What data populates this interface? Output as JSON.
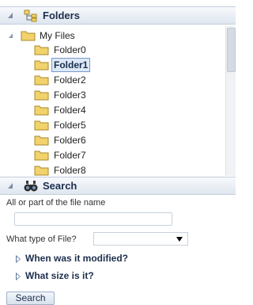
{
  "folders_panel": {
    "title": "Folders",
    "icon": "folder-tree-icon",
    "root": {
      "label": "My Files",
      "expanded": true
    },
    "items": [
      {
        "label": "Folder0",
        "selected": false
      },
      {
        "label": "Folder1",
        "selected": true
      },
      {
        "label": "Folder2",
        "selected": false
      },
      {
        "label": "Folder3",
        "selected": false
      },
      {
        "label": "Folder4",
        "selected": false
      },
      {
        "label": "Folder5",
        "selected": false
      },
      {
        "label": "Folder6",
        "selected": false
      },
      {
        "label": "Folder7",
        "selected": false
      },
      {
        "label": "Folder8",
        "selected": false
      }
    ]
  },
  "search_panel": {
    "title": "Search",
    "icon": "binoculars-icon",
    "name_label": "All or part of the file name",
    "name_value": "",
    "type_label": "What type of File?",
    "type_value": "",
    "modified_toggle": "When was it modified?",
    "size_toggle": "What size is it?",
    "search_button": "Search"
  },
  "colors": {
    "header_text": "#1d2f4d",
    "selection_bg": "#dce8f7",
    "selection_border": "#7a9acb",
    "folder_yellow": "#f2d26a"
  }
}
